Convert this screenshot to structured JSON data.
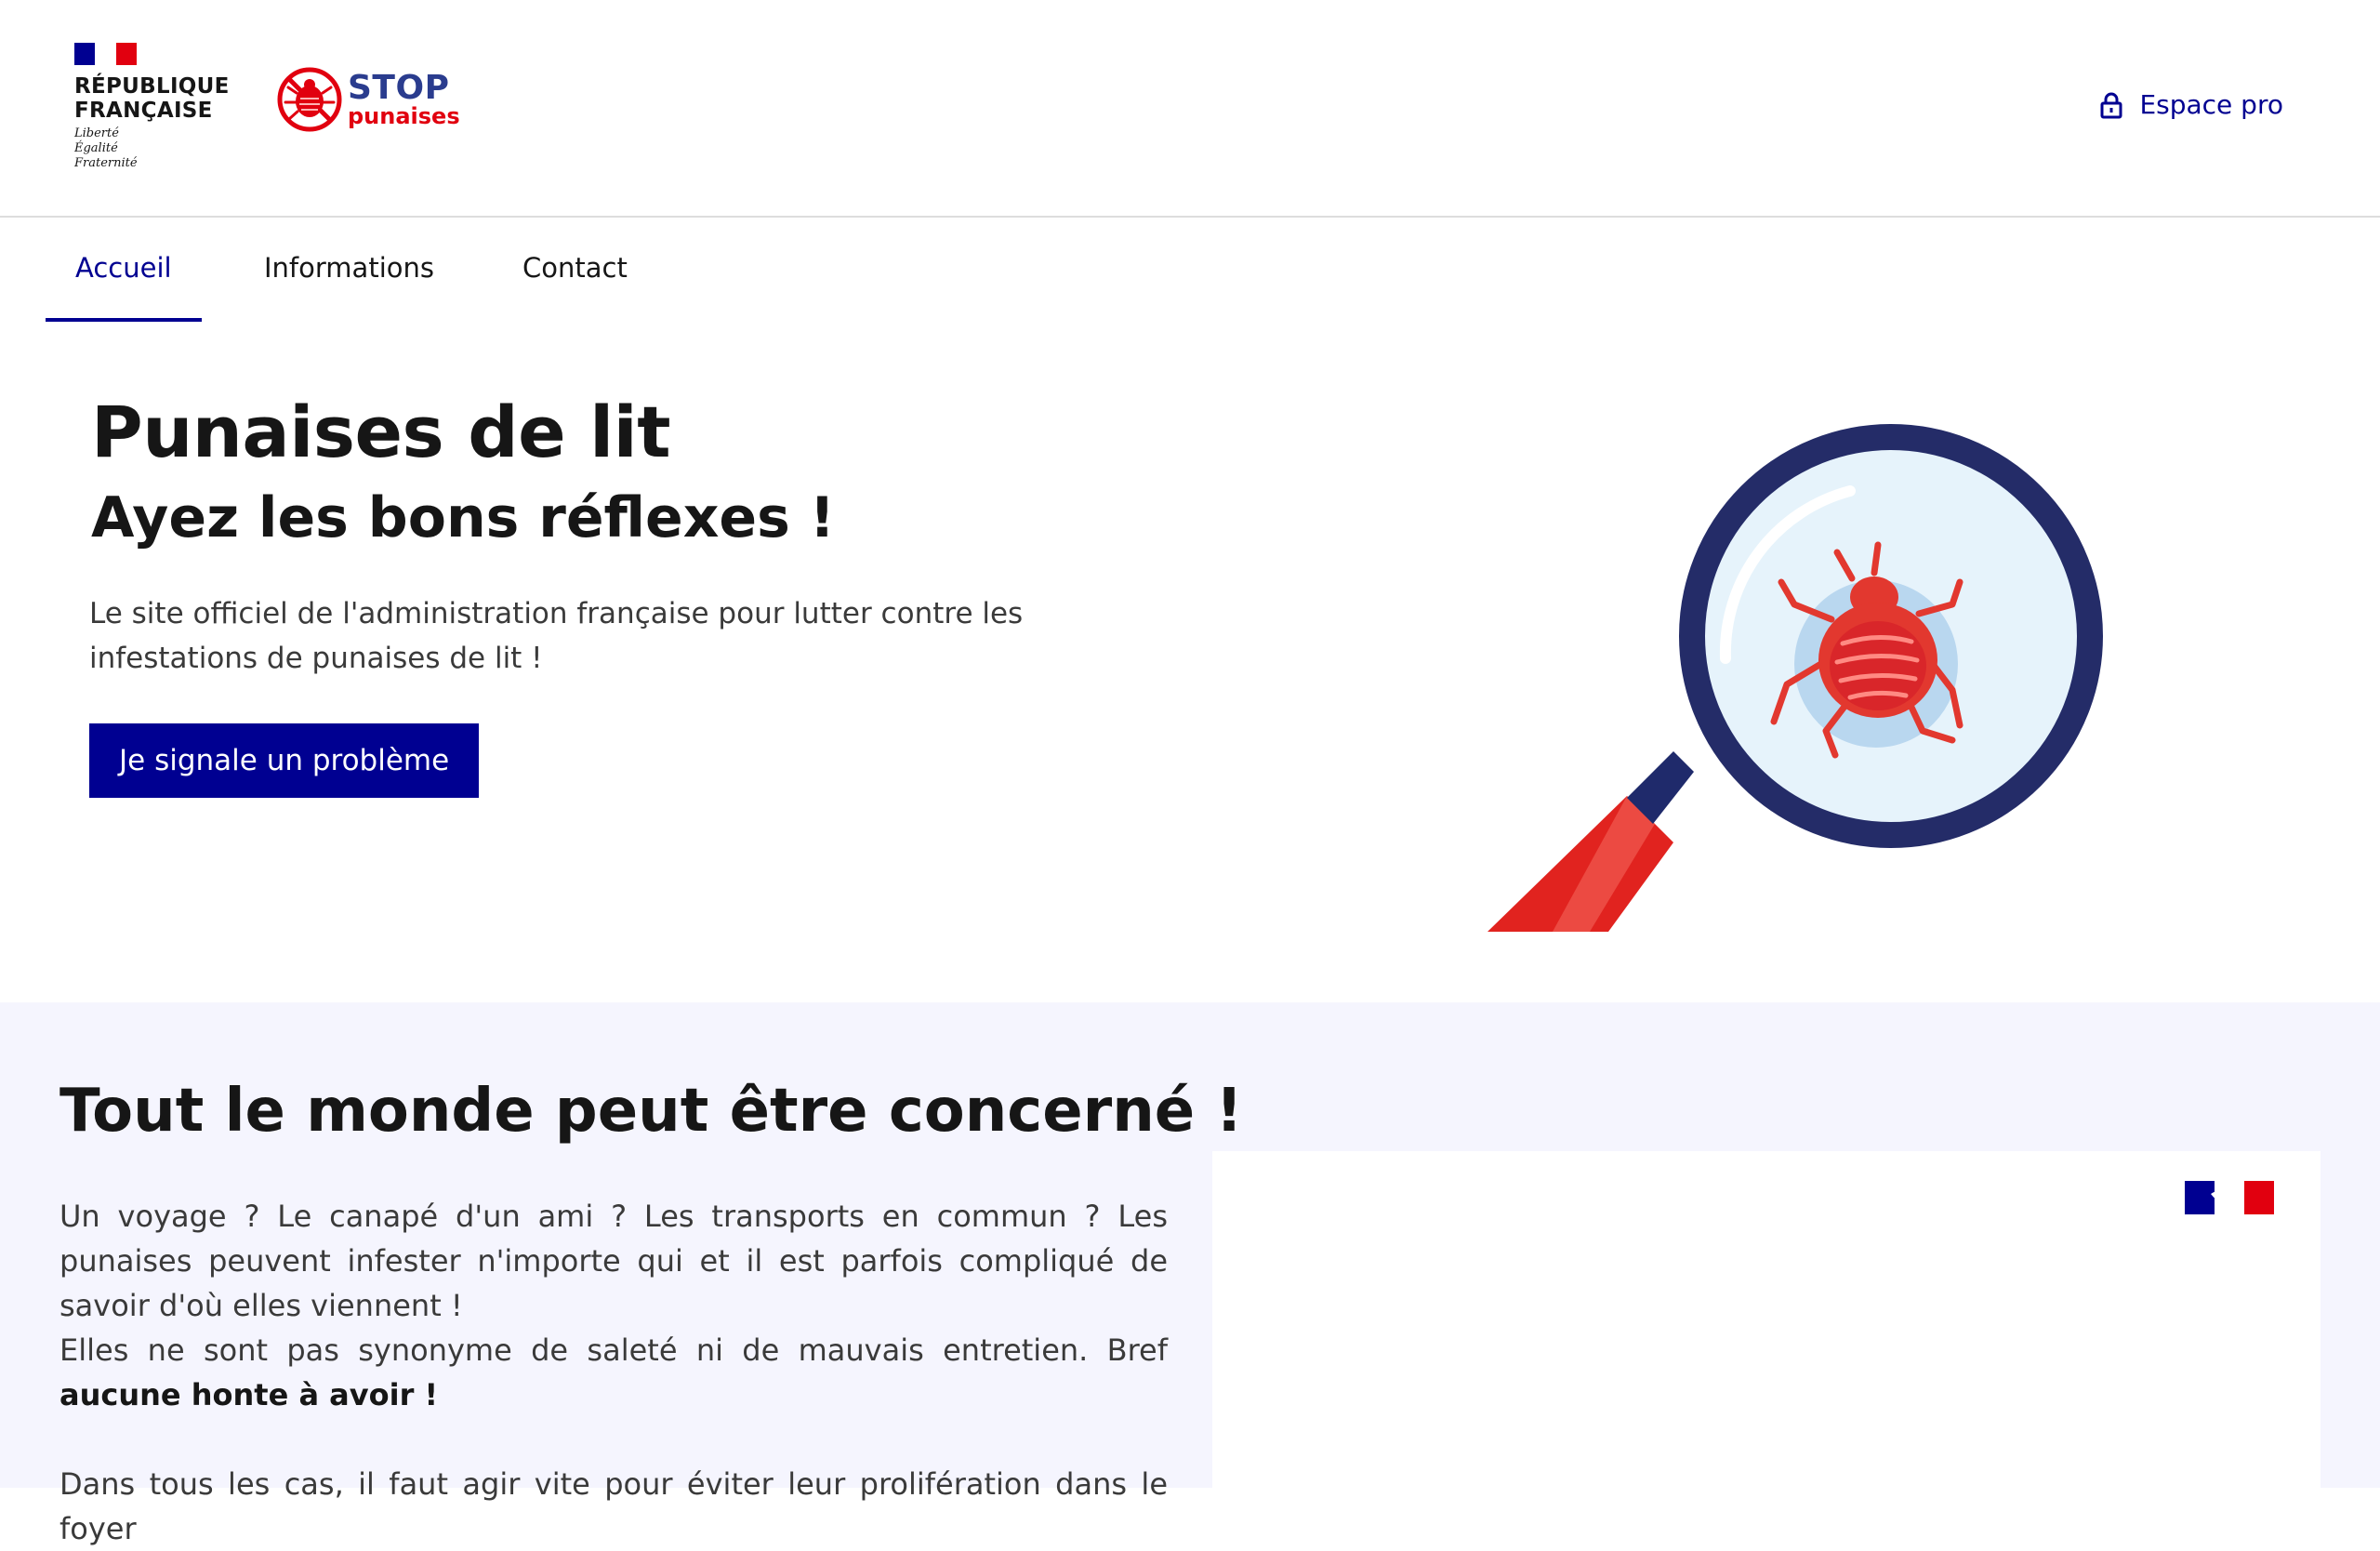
{
  "header": {
    "republic": {
      "line1": "RÉPUBLIQUE",
      "line2": "FRANÇAISE"
    },
    "motto": [
      "Liberté",
      "Égalité",
      "Fraternité"
    ],
    "logo": {
      "line1": "STOP",
      "line2": "punaises",
      "icon": "bedbug-stop-icon"
    },
    "espace_pro": {
      "label": "Espace pro",
      "icon": "lock-icon"
    }
  },
  "nav": {
    "items": [
      {
        "label": "Accueil",
        "active": true
      },
      {
        "label": "Informations",
        "active": false
      },
      {
        "label": "Contact",
        "active": false
      }
    ]
  },
  "hero": {
    "title": "Punaises de lit",
    "subtitle": "Ayez les bons réflexes !",
    "description": "Le site officiel de l'administration française pour lutter contre les infestations de punaises de lit !",
    "cta_label": "Je signale un problème",
    "illustration": "magnifying-glass-bedbug-illustration"
  },
  "section": {
    "title": "Tout le monde peut être concerné !",
    "paragraph1": "Un voyage ? Le canapé d'un ami ? Les transports en commun ? Les punaises peuvent infester n'importe qui et il est parfois compliqué de savoir d'où elles viennent !",
    "paragraph2_text": "Elles ne sont pas synonyme de saleté ni de mauvais entretien. Bref ",
    "paragraph2_bold": "aucune honte à avoir !",
    "paragraph3": "Dans tous les cas, il faut agir vite pour éviter leur prolifération dans le foyer"
  },
  "colors": {
    "primary": "#000091",
    "red": "#e1000f",
    "section_bg": "#f5f5fe",
    "text": "#161616"
  }
}
